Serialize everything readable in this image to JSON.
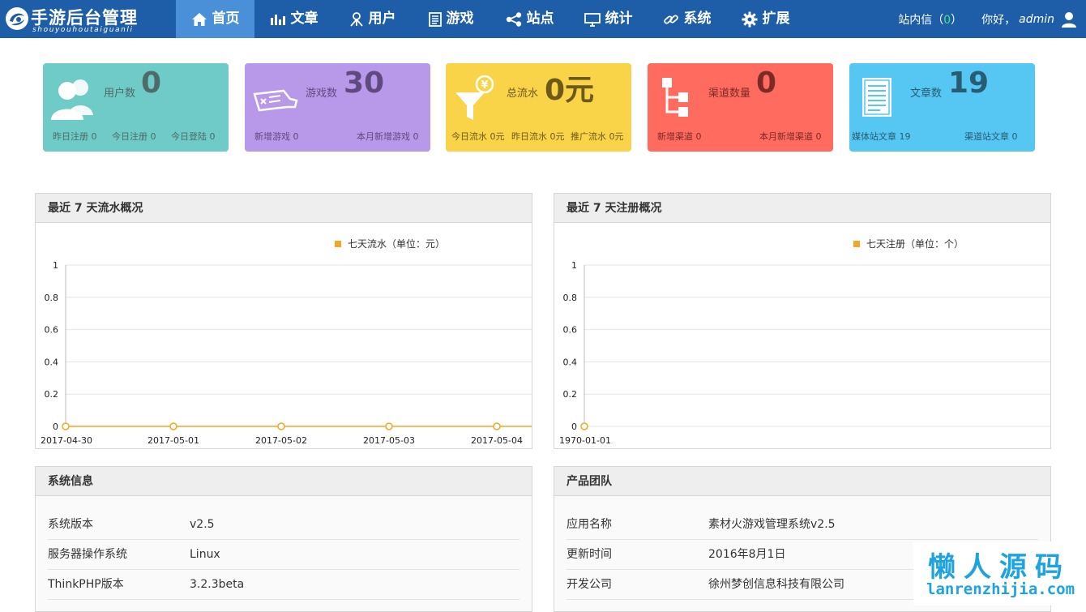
{
  "brand": {
    "title": "手游后台管理",
    "subtitle": "shouyouhoutaiguanli"
  },
  "nav": [
    {
      "label": "首页",
      "icon": "home-icon",
      "active": true
    },
    {
      "label": "文章",
      "icon": "bar-chart-icon",
      "active": false
    },
    {
      "label": "用户",
      "icon": "user-tie-icon",
      "active": false
    },
    {
      "label": "游戏",
      "icon": "document-icon",
      "active": false
    },
    {
      "label": "站点",
      "icon": "share-icon",
      "active": false
    },
    {
      "label": "统计",
      "icon": "monitor-icon",
      "active": false
    },
    {
      "label": "系统",
      "icon": "link-icon",
      "active": false
    },
    {
      "label": "扩展",
      "icon": "gear-icon",
      "active": false
    }
  ],
  "topright": {
    "messages_label": "站内信",
    "messages_open": "（",
    "messages_count": "0",
    "messages_close": "）",
    "greeting": "你好，",
    "username": "admin"
  },
  "cards": [
    {
      "label": "用户数",
      "value": "0",
      "subs": [
        "昨日注册 0",
        "今日注册 0",
        "今日登陆 0"
      ],
      "icon": "users-icon"
    },
    {
      "label": "游戏数",
      "value": "30",
      "subs": [
        "新增游戏 0",
        "本月新增游戏 0"
      ],
      "icon": "game-pad-icon"
    },
    {
      "label": "总流水",
      "value": "0元",
      "subs": [
        "今日流水 0元",
        "昨日流水 0元",
        "推广流水 0元"
      ],
      "icon": "funnel-yen-icon"
    },
    {
      "label": "渠道数量",
      "value": "0",
      "subs": [
        "新增渠道 0",
        "本月新增渠道 0"
      ],
      "icon": "sitemap-icon"
    },
    {
      "label": "文章数",
      "value": "19",
      "subs": [
        "媒体站文章 19",
        "渠道站文章 0"
      ],
      "icon": "article-icon"
    }
  ],
  "panels": {
    "revenue_title": "最近 7 天流水概况",
    "register_title": "最近 7 天注册概况",
    "system_title": "系统信息",
    "team_title": "产品团队"
  },
  "chart_data": [
    {
      "type": "line",
      "title": "",
      "legend": "七天流水（单位：元）",
      "legend_position": "top-right",
      "grid": true,
      "color": "#f5a623",
      "x": [
        "2017-04-30",
        "2017-05-01",
        "2017-05-02",
        "2017-05-03",
        "2017-05-04"
      ],
      "y": [
        0,
        0,
        0,
        0,
        0
      ],
      "ylim": [
        0,
        1
      ],
      "yticks": [
        "1",
        "0.8",
        "0.6",
        "0.4",
        "0.2",
        "0"
      ]
    },
    {
      "type": "line",
      "title": "",
      "legend": "七天注册（单位：个）",
      "legend_position": "top-right",
      "grid": true,
      "color": "#f5a623",
      "x": [
        "1970-01-01"
      ],
      "y": [
        0
      ],
      "ylim": [
        0,
        1
      ],
      "yticks": [
        "1",
        "0.8",
        "0.6",
        "0.4",
        "0.2",
        "0"
      ]
    }
  ],
  "system_info": [
    {
      "key": "系统版本",
      "value": "v2.5"
    },
    {
      "key": "服务器操作系统",
      "value": "Linux"
    },
    {
      "key": "ThinkPHP版本",
      "value": "3.2.3beta"
    }
  ],
  "team_info": [
    {
      "key": "应用名称",
      "value": "素材火游戏管理系统v2.5"
    },
    {
      "key": "更新时间",
      "value": "2016年8月1日"
    },
    {
      "key": "开发公司",
      "value": "徐州梦创信息科技有限公司"
    }
  ],
  "watermark": {
    "cn": "懒人源码",
    "en": "lanrenzhijia.com"
  }
}
